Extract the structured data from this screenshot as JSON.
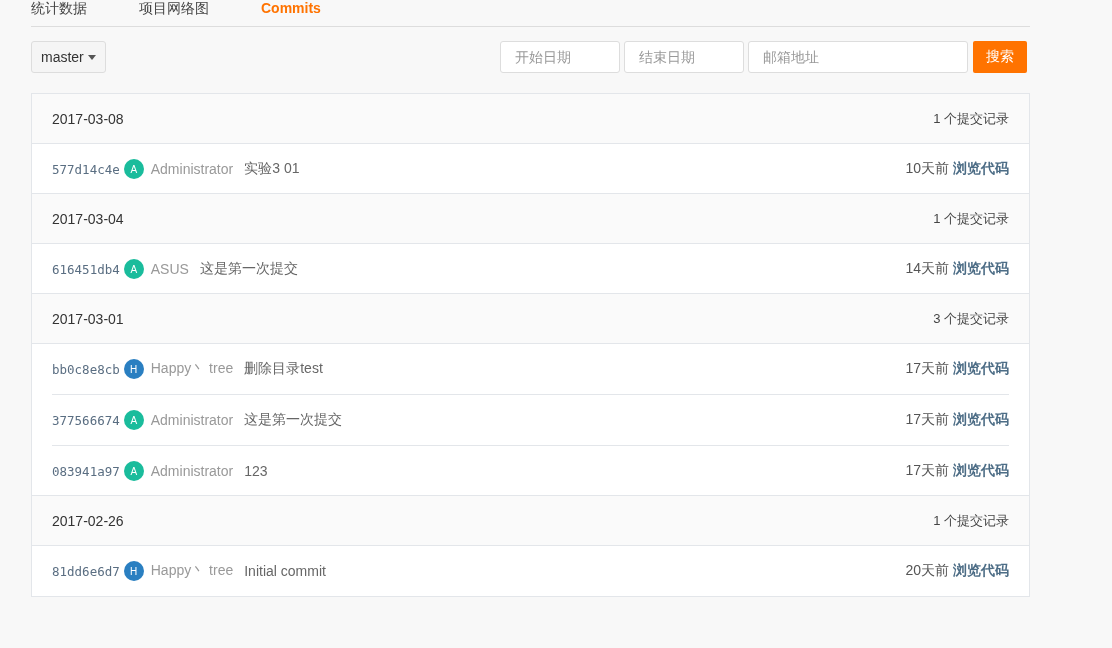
{
  "tabs": [
    {
      "label": "统计数据",
      "selected": false
    },
    {
      "label": "项目网络图",
      "selected": false
    },
    {
      "label": "Commits",
      "selected": true
    }
  ],
  "branch": {
    "label": "master"
  },
  "filters": [
    {
      "placeholder": "开始日期"
    },
    {
      "placeholder": "结束日期"
    },
    {
      "placeholder": "邮箱地址"
    }
  ],
  "search_button": "搜索",
  "groups": [
    {
      "date": "2017-03-08",
      "count": "1 个提交记录",
      "commits": [
        {
          "sha": "577d14c4e",
          "avatar": "A",
          "color": "#1abc9c",
          "author": "Administrator",
          "message": "实验3 01",
          "time": "10天前",
          "browse": "浏览代码"
        }
      ]
    },
    {
      "date": "2017-03-04",
      "count": "1 个提交记录",
      "commits": [
        {
          "sha": "616451db4",
          "avatar": "A",
          "color": "#1abc9c",
          "author": "ASUS",
          "message": "这是第一次提交",
          "time": "14天前",
          "browse": "浏览代码"
        }
      ]
    },
    {
      "date": "2017-03-01",
      "count": "3 个提交记录",
      "commits": [
        {
          "sha": "bb0c8e8cb",
          "avatar": "H",
          "color": "#2a7fc1",
          "author": "Happy丶 tree",
          "message": "删除目录test",
          "time": "17天前",
          "browse": "浏览代码"
        },
        {
          "sha": "377566674",
          "avatar": "A",
          "color": "#1abc9c",
          "author": "Administrator",
          "message": "这是第一次提交",
          "time": "17天前",
          "browse": "浏览代码"
        },
        {
          "sha": "083941a97",
          "avatar": "A",
          "color": "#1abc9c",
          "author": "Administrator",
          "message": "123",
          "time": "17天前",
          "browse": "浏览代码"
        }
      ]
    },
    {
      "date": "2017-02-26",
      "count": "1 个提交记录",
      "commits": [
        {
          "sha": "81dd6e6d7",
          "avatar": "H",
          "color": "#2a7fc1",
          "author": "Happy丶 tree",
          "message": "Initial commit",
          "time": "20天前",
          "browse": "浏览代码"
        }
      ]
    }
  ]
}
